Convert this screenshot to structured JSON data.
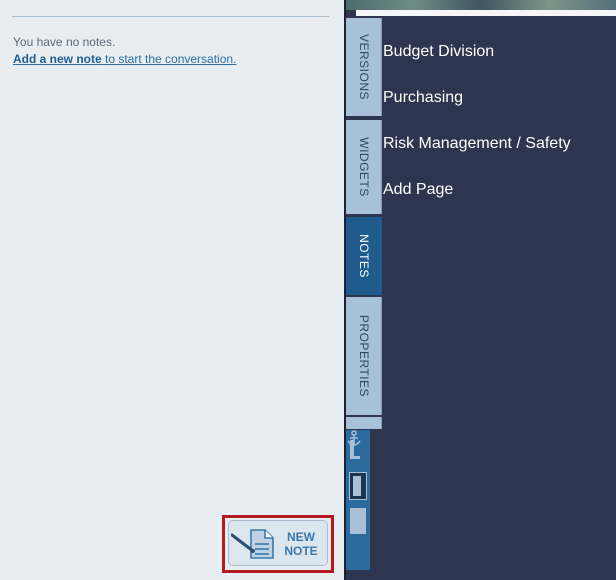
{
  "notes": {
    "empty_message": "You have no notes.",
    "add_link_label": "Add a new note",
    "add_link_suffix": " to start the conversation.",
    "new_note_label_line1": "NEW",
    "new_note_label_line2": "NOTE"
  },
  "tabs": [
    {
      "label": "VERSIONS",
      "active": false
    },
    {
      "label": "WIDGETS",
      "active": false
    },
    {
      "label": "NOTES",
      "active": true
    },
    {
      "label": "PROPERTIES",
      "active": false
    }
  ],
  "site_nav": {
    "items": [
      "Budget Division",
      "Purchasing",
      "Risk Management / Safety",
      "Add Page"
    ]
  },
  "colors": {
    "accent": "#1f5b8e",
    "highlight": "#b4191f",
    "nav_background": "#2e364f",
    "panel_background": "#e8edf2"
  }
}
